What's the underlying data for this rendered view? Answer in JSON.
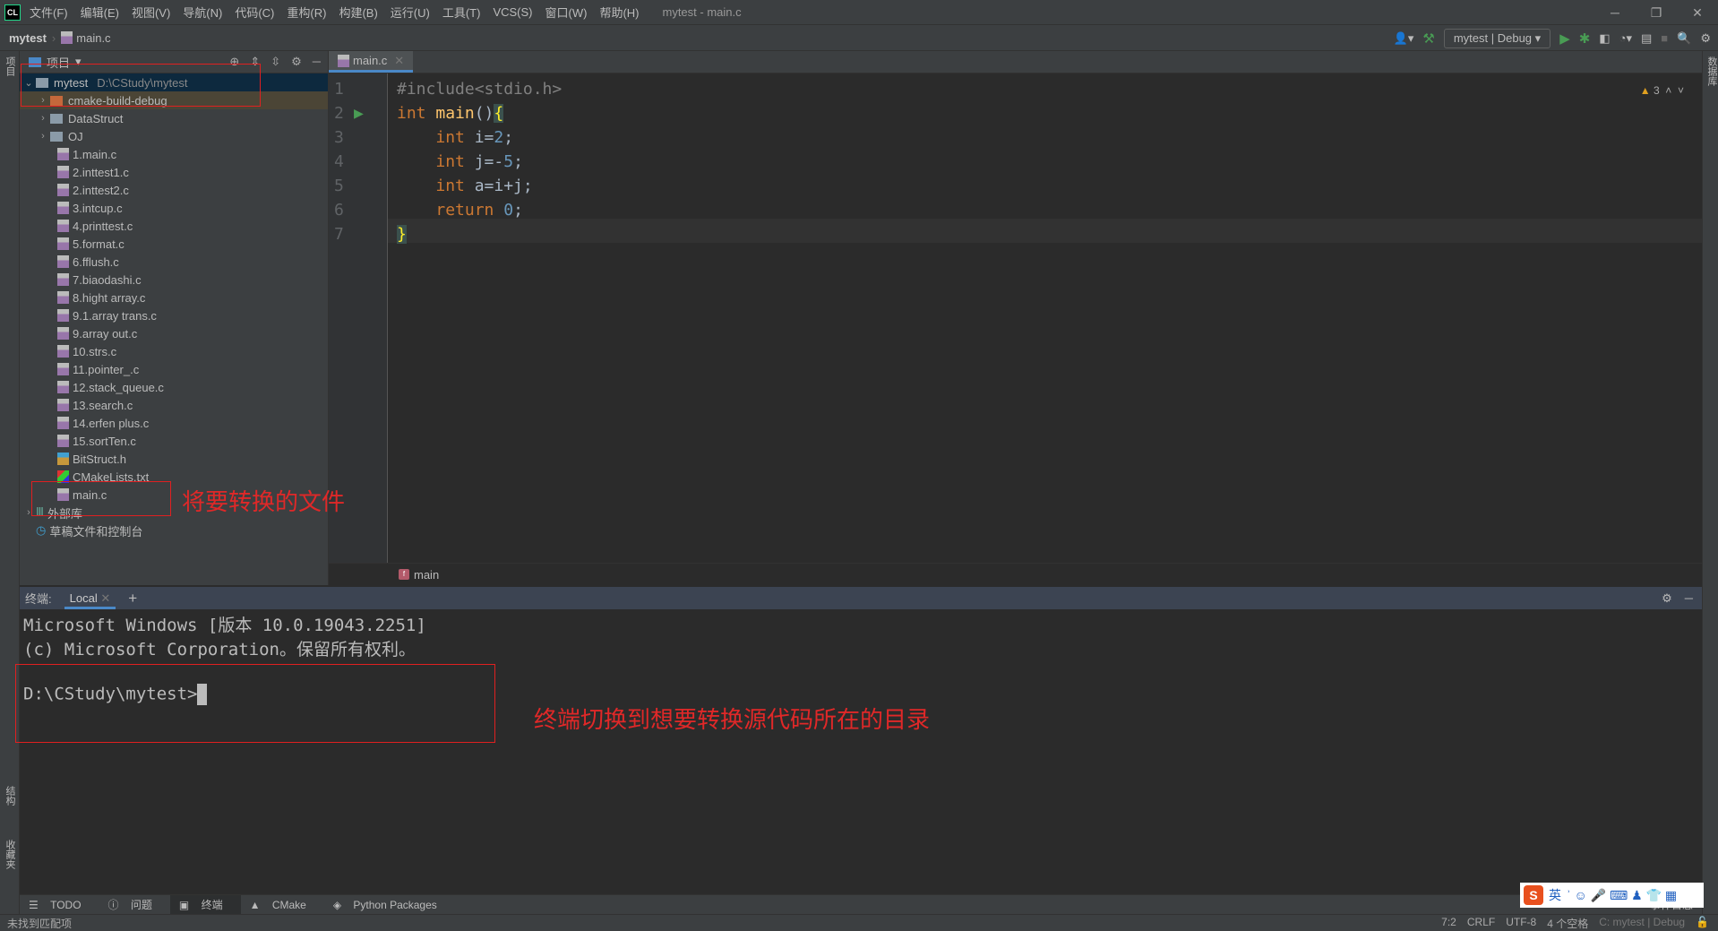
{
  "titlebar": {
    "logo": "CL",
    "menus": [
      "文件(F)",
      "编辑(E)",
      "视图(V)",
      "导航(N)",
      "代码(C)",
      "重构(R)",
      "构建(B)",
      "运行(U)",
      "工具(T)",
      "VCS(S)",
      "窗口(W)",
      "帮助(H)"
    ],
    "title": "mytest - main.c"
  },
  "navbar": {
    "project": "mytest",
    "file": "main.c",
    "run_config": "mytest | Debug"
  },
  "left_strip": {
    "project": "项目",
    "structure": "结构",
    "bookmarks": "收藏夹"
  },
  "right_strip": {
    "database": "数据库"
  },
  "project_panel": {
    "title": "项目",
    "root": {
      "name": "mytest",
      "path": "D:\\CStudy\\mytest"
    },
    "folders": [
      "cmake-build-debug",
      "DataStruct",
      "OJ"
    ],
    "files": [
      "1.main.c",
      "2.inttest1.c",
      "2.inttest2.c",
      "3.intcup.c",
      "4.printtest.c",
      "5.format.c",
      "6.fflush.c",
      "7.biaodashi.c",
      "8.hight array.c",
      "9.1.array trans.c",
      "9.array out.c",
      "10.strs.c",
      "11.pointer_.c",
      "12.stack_queue.c",
      "13.search.c",
      "14.erfen plus.c",
      "15.sortTen.c",
      "BitStruct.h",
      "CMakeLists.txt",
      "main.c"
    ],
    "external": "外部库",
    "scratches": "草稿文件和控制台"
  },
  "editor": {
    "tab": "main.c",
    "warnings": "3",
    "line_numbers": [
      "1",
      "2",
      "3",
      "4",
      "5",
      "6",
      "7"
    ],
    "lines": [
      {
        "pp": "#include<stdio.h>"
      },
      {
        "kw": "int",
        "fn": " main",
        "rest": "()",
        "brace": "{"
      },
      {
        "kw": "int",
        "rest": " i=",
        "num": "2",
        "end": ";"
      },
      {
        "kw": "int",
        "rest": " j=-",
        "num": "5",
        "end": ";"
      },
      {
        "kw": "int",
        "rest": " a=i+j;"
      },
      {
        "kw": "return",
        "num": " 0",
        "end": ";"
      },
      {
        "brace": "}"
      }
    ],
    "breadcrumb": "main"
  },
  "terminal": {
    "label": "终端:",
    "tab": "Local",
    "lines": [
      "Microsoft Windows [版本 10.0.19043.2251]",
      "(c) Microsoft Corporation。保留所有权利。"
    ],
    "prompt": "D:\\CStudy\\mytest>"
  },
  "tool_tabs": [
    "TODO",
    "问题",
    "终端",
    "CMake",
    "Python Packages"
  ],
  "status": {
    "left": "未找到匹配项",
    "position": "7:2",
    "line_ending": "CRLF",
    "encoding": "UTF-8",
    "indent": "4 个空格",
    "context": "C: mytest | Debug",
    "event_log": "事件日志"
  },
  "ime": {
    "logo": "S",
    "mode": "英"
  },
  "annotations": {
    "file_note": "将要转换的文件",
    "terminal_note": "终端切换到想要转换源代码所在的目录",
    "color": "#e02020"
  }
}
